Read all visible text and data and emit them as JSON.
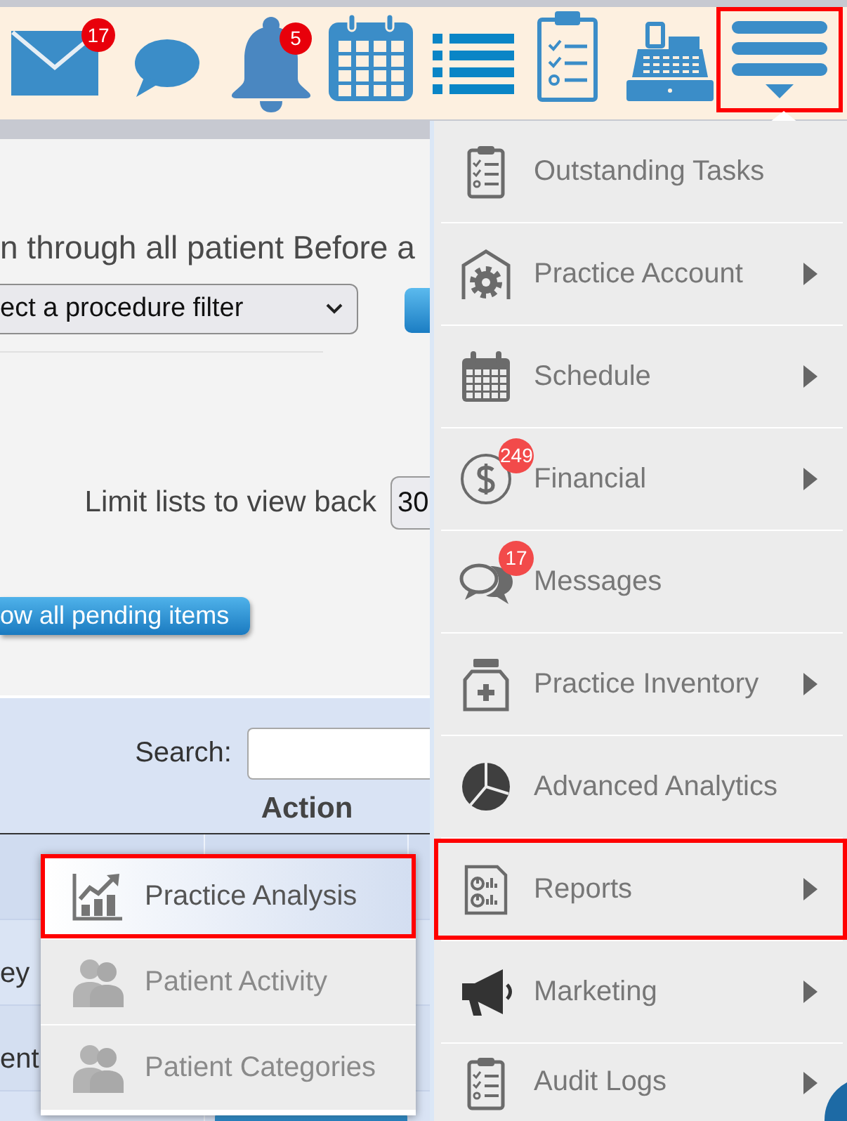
{
  "toolbar": {
    "mail_badge": "17",
    "bell_badge": "5",
    "menu_button": {
      "highlighted": true
    }
  },
  "content": {
    "heading": "n through all patient Before a",
    "procedure_filter": {
      "value": "ect a procedure filter"
    },
    "limit_label": "Limit lists to view back",
    "limit_select": {
      "value": "30"
    },
    "pending_button": "ow all pending items"
  },
  "table": {
    "search_label": "Search:",
    "action_header": "Action",
    "rows": [
      {
        "column_1": "ey"
      },
      {
        "column_1": "ent"
      }
    ]
  },
  "submenu": {
    "items": [
      {
        "label": "Practice Analysis",
        "selected": true,
        "highlighted": true
      },
      {
        "label": "Patient Activity",
        "selected": false,
        "highlighted": false
      },
      {
        "label": "Patient Categories",
        "selected": false,
        "highlighted": false
      }
    ]
  },
  "menu": {
    "items": [
      {
        "label": "Outstanding Tasks",
        "has_submenu": false,
        "highlighted": false
      },
      {
        "label": "Practice Account",
        "has_submenu": true,
        "highlighted": false
      },
      {
        "label": "Schedule",
        "has_submenu": true,
        "highlighted": false
      },
      {
        "label": "Financial",
        "has_submenu": true,
        "badge": "249",
        "highlighted": false
      },
      {
        "label": "Messages",
        "has_submenu": false,
        "badge": "17",
        "highlighted": false
      },
      {
        "label": "Practice Inventory",
        "has_submenu": true,
        "highlighted": false
      },
      {
        "label": "Advanced Analytics",
        "has_submenu": false,
        "highlighted": false
      },
      {
        "label": "Reports",
        "has_submenu": true,
        "highlighted": true
      },
      {
        "label": "Marketing",
        "has_submenu": true,
        "highlighted": false
      },
      {
        "label": "Audit Logs",
        "has_submenu": true,
        "highlighted": false
      }
    ]
  }
}
